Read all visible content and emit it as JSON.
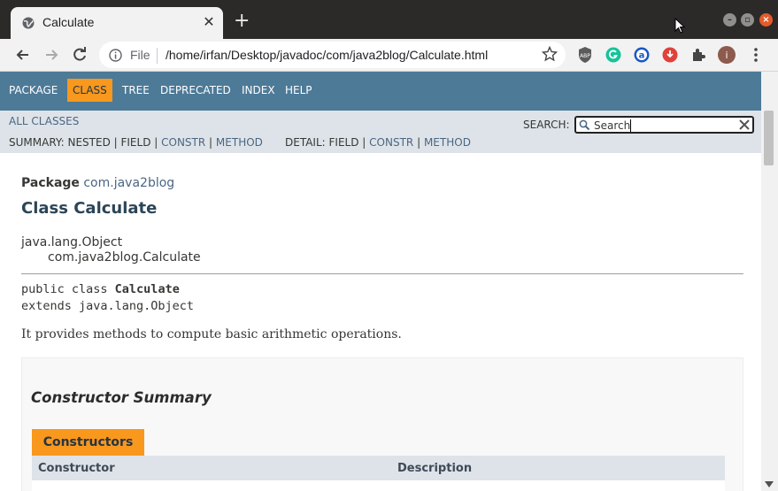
{
  "browser": {
    "tab_title": "Calculate",
    "tab_close": "✕",
    "new_tab": "+",
    "address": {
      "scheme_label": "File",
      "url": "/home/irfan/Desktop/javadoc/com/java2blog/Calculate.html"
    },
    "profile_initial": "i",
    "colors": {
      "chrome_dark": "#2b2a29",
      "toolbar": "#f2f2f2",
      "close": "#e45a2a"
    }
  },
  "javadoc": {
    "nav": [
      "PACKAGE",
      "CLASS",
      "TREE",
      "DEPRECATED",
      "INDEX",
      "HELP"
    ],
    "active_nav": "CLASS",
    "all_classes": "ALL CLASSES",
    "search_label": "SEARCH:",
    "search_placeholder": "Search",
    "summary": {
      "prefix": "SUMMARY: NESTED | FIELD |",
      "constr": "CONSTR",
      "sep": "|",
      "method": "METHOD"
    },
    "detail": {
      "prefix": "DETAIL: FIELD |",
      "constr": "CONSTR",
      "sep": "|",
      "method": "METHOD"
    },
    "package_label": "Package",
    "package_name": "com.java2blog",
    "class_title": "Class Calculate",
    "inheritance": [
      "java.lang.Object",
      "com.java2blog.Calculate"
    ],
    "declaration": {
      "line1_prefix": "public class ",
      "line1_name": "Calculate",
      "line2": "extends java.lang.Object"
    },
    "description": "It provides methods to compute basic arithmetic operations.",
    "constructor_summary": {
      "title": "Constructor Summary",
      "tab": "Constructors",
      "columns": [
        "Constructor",
        "Description"
      ]
    },
    "colors": {
      "nav_bg": "#4d7a97",
      "active": "#f8981d",
      "subnav_bg": "#dee3e9",
      "link": "#4a6782",
      "title": "#2c4557"
    }
  }
}
